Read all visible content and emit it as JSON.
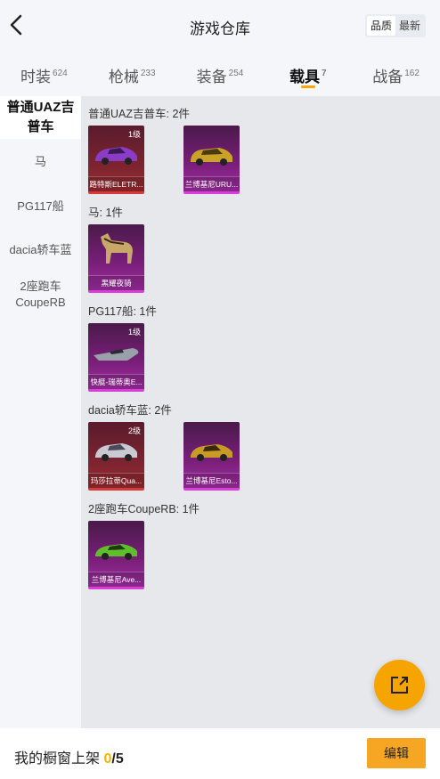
{
  "header": {
    "title": "游戏仓库",
    "sort": [
      "品质",
      "最新"
    ],
    "sort_active": 0
  },
  "tabs": [
    {
      "label": "时装",
      "count": "624"
    },
    {
      "label": "枪械",
      "count": "233"
    },
    {
      "label": "装备",
      "count": "254"
    },
    {
      "label": "载具",
      "count": "7",
      "active": true
    },
    {
      "label": "战备",
      "count": "162"
    }
  ],
  "sidebar": {
    "items": [
      {
        "label": "普通UAZ吉普车",
        "active": true
      },
      {
        "label": "马"
      },
      {
        "label": "PG117船"
      },
      {
        "label": "dacia轿车蓝"
      },
      {
        "label": "2座跑车CoupeRB"
      }
    ]
  },
  "groups": [
    {
      "label": "普通UAZ吉普车: 2件",
      "items": [
        {
          "name": "路特斯ELETR...",
          "level": "1级",
          "rarity": "red",
          "icon": "purple-car-icon",
          "color": "#8a3cc7"
        },
        {
          "name": "兰博基尼URU...",
          "level": "",
          "rarity": "purple",
          "icon": "gold-suv-icon",
          "color": "#c9a227"
        }
      ]
    },
    {
      "label": "马: 1件",
      "items": [
        {
          "name": "黑耀夜骑",
          "level": "",
          "rarity": "purple",
          "icon": "horse-icon",
          "color": "#c8a86a"
        }
      ]
    },
    {
      "label": "PG117船: 1件",
      "items": [
        {
          "name": "快艇-瑞蒂奥E...",
          "level": "1级",
          "rarity": "purple",
          "icon": "speedboat-icon",
          "color": "#9aa0aa"
        }
      ]
    },
    {
      "label": "dacia轿车蓝: 2件",
      "items": [
        {
          "name": "玛莎拉蒂Qua...",
          "level": "2级",
          "rarity": "red",
          "icon": "silver-car-icon",
          "color": "#c9c9d2"
        },
        {
          "name": "兰博基尼Esto...",
          "level": "",
          "rarity": "purple",
          "icon": "gold-car-icon",
          "color": "#c99a25"
        }
      ]
    },
    {
      "label": "2座跑车CoupeRB: 1件",
      "items": [
        {
          "name": "兰博基尼Ave...",
          "level": "",
          "rarity": "purple",
          "icon": "green-car-icon",
          "color": "#5fbf2a"
        }
      ]
    }
  ],
  "footer": {
    "label": "我的橱窗上架",
    "current": "0",
    "total": "/5",
    "edit_label": "编辑"
  },
  "colors": {
    "accent": "#f6a623",
    "rarity_red": "#d63a3a",
    "rarity_purple": "#d93ed9"
  }
}
